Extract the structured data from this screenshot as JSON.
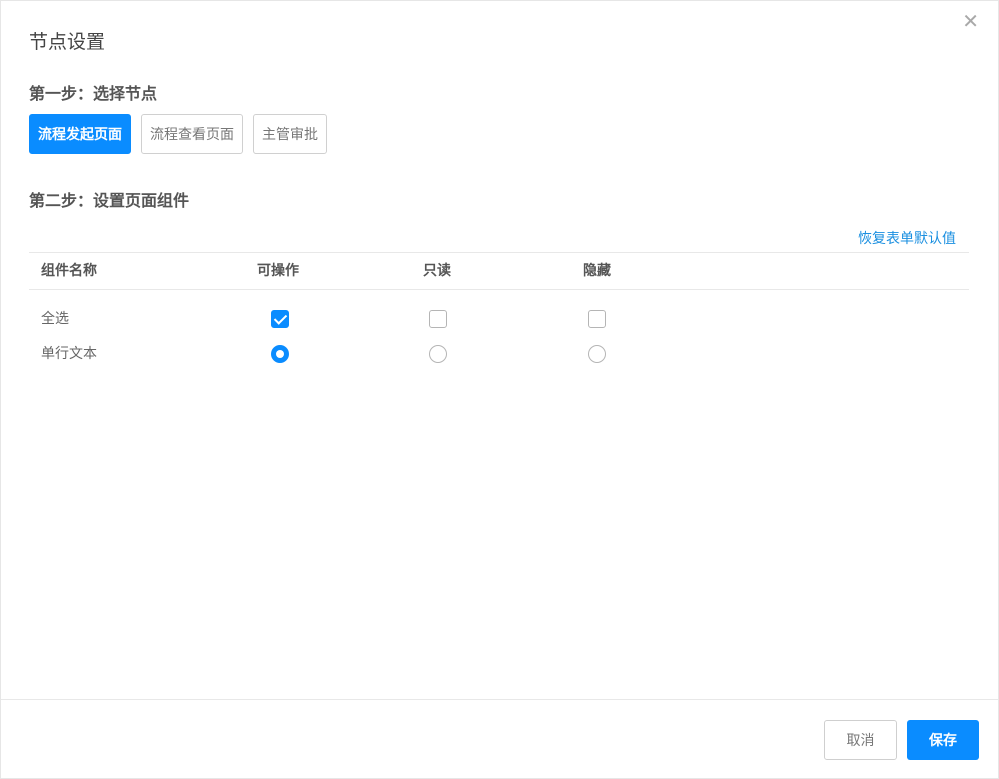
{
  "dialog": {
    "title": "节点设置",
    "close_icon": "close-icon"
  },
  "step1": {
    "title": "第一步：选择节点",
    "nodes": [
      {
        "label": "流程发起页面",
        "active": true
      },
      {
        "label": "流程查看页面",
        "active": false
      },
      {
        "label": "主管审批",
        "active": false
      }
    ]
  },
  "step2": {
    "title": "第二步：设置页面组件",
    "restore_link": "恢复表单默认值",
    "columns": [
      "组件名称",
      "可操作",
      "只读",
      "隐藏"
    ],
    "rows": [
      {
        "label": "全选",
        "control": "checkbox",
        "selected": "可操作"
      },
      {
        "label": "单行文本",
        "control": "radio",
        "selected": "可操作"
      }
    ]
  },
  "footer": {
    "cancel_label": "取消",
    "save_label": "保存"
  },
  "colors": {
    "accent": "#0a8cff",
    "link": "#1a8fe0"
  }
}
